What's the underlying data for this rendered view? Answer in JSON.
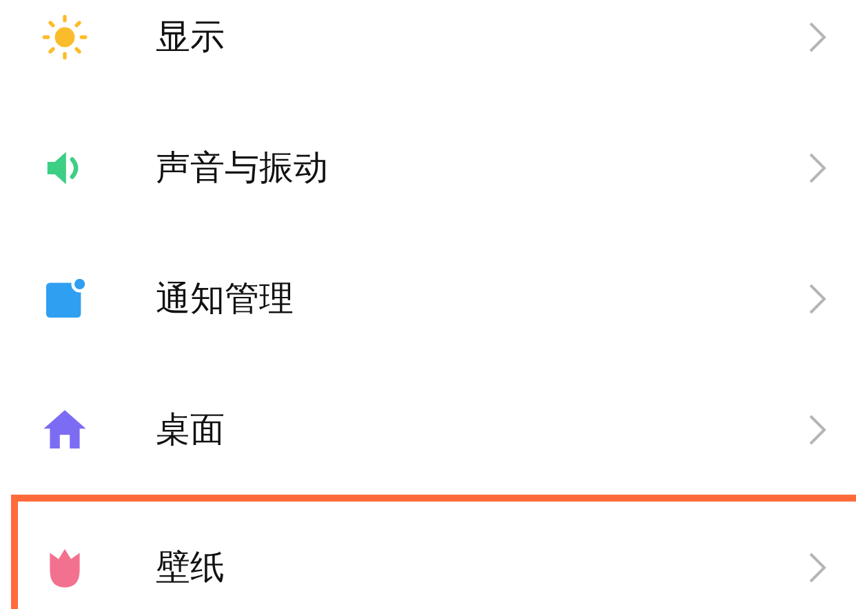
{
  "items": [
    {
      "label": "显示",
      "highlighted": false
    },
    {
      "label": "声音与振动",
      "highlighted": false
    },
    {
      "label": "通知管理",
      "highlighted": false
    },
    {
      "label": "桌面",
      "highlighted": false
    },
    {
      "label": "壁纸",
      "highlighted": true
    }
  ]
}
